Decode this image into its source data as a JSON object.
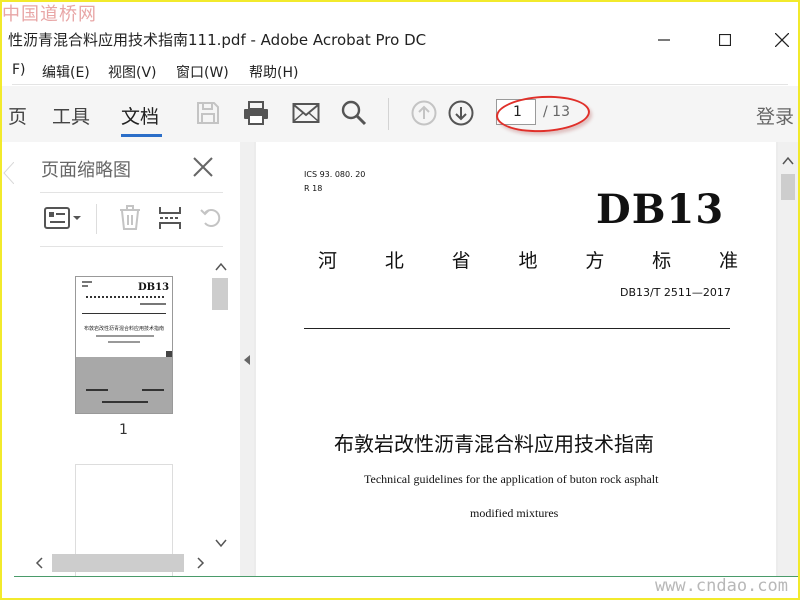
{
  "watermarks": {
    "top": "中国道桥网",
    "bottom": "www.cndao.com"
  },
  "window": {
    "title": "性沥青混合料应用技术指南111.pdf - Adobe Acrobat Pro DC"
  },
  "menu": {
    "items": [
      {
        "label": "F)"
      },
      {
        "label": "编辑(E)"
      },
      {
        "label": "视图(V)"
      },
      {
        "label": "窗口(W)"
      },
      {
        "label": "帮助(H)"
      }
    ]
  },
  "toolbar": {
    "tabs": [
      {
        "label": "页"
      },
      {
        "label": "工具"
      },
      {
        "label": "文档"
      }
    ],
    "active_tab": "文档",
    "accent_color": "#2b6ec8",
    "current_page": "1",
    "page_total": "/ 13",
    "login": "登录",
    "annotation_color": "#e0302a",
    "icons": [
      "save-icon",
      "print-icon",
      "mail-icon",
      "search-icon",
      "page-up-icon",
      "page-down-icon"
    ]
  },
  "thumbnail_panel": {
    "title": "页面缩略图",
    "page_label": "1",
    "icons": [
      "options-icon",
      "delete-icon",
      "extract-icon",
      "rotate-icon",
      "close-icon"
    ],
    "thumb": {
      "code": "DB13",
      "title": "布敦岩改性沥青混合料应用技术指南"
    }
  },
  "document": {
    "ics": "ICS 93. 080. 20",
    "r": "R 18",
    "code": "DB13",
    "province_chars": [
      "河",
      "北",
      "省",
      "地",
      "方",
      "标",
      "准"
    ],
    "std_no": "DB13/T 2511—2017",
    "title_cn": "布敦岩改性沥青混合料应用技术指南",
    "title_en_1": "Technical guidelines for the application of buton rock asphalt",
    "title_en_2": "modified mixtures"
  }
}
